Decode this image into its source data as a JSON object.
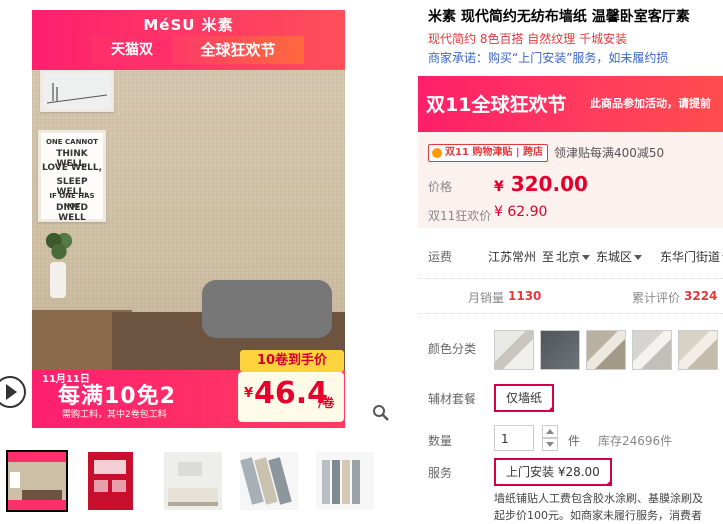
{
  "gallery": {
    "brand": "MéSU 米素",
    "tmall_left": "天猫双",
    "tmall_right": "全球狂欢节",
    "wall_quote": [
      "ONE CANNOT",
      "THINK WELL,",
      "LOVE WELL,",
      "SLEEP WELL,",
      "IF ONE HAS NOT",
      "DINED WELL"
    ],
    "promo_date": "11月11日",
    "promo_main": "每满10免2",
    "promo_sub": "需购工料，其中2卷包工料",
    "promo_tag": "10卷到手价",
    "promo_currency": "¥",
    "promo_price": "46.4",
    "promo_unit": "/卷",
    "thumbnail_count": 5
  },
  "product": {
    "title": "米素 现代简约无纺布墙纸 温馨卧室客厅素",
    "subtitle": "现代简约 8色百搭 自然纹理 千城安装",
    "promise": "商家承诺：购买“上门安装”服务，如未履约损",
    "event_title": "双11全球狂欢节",
    "event_sub": "此商品参加活动，请提前",
    "coupon_badge": "双11 购物津贴 | 跨店",
    "coupon_text": "领津贴每满400减50",
    "price_label": "价格",
    "price_currency": "¥",
    "price_value": "320.00",
    "promo_price_label": "双11狂欢价",
    "promo_price": "¥ 62.90",
    "shipping_label": "运费",
    "ship_from": "江苏常州",
    "ship_to_prefix": "至",
    "ship_city": "北京",
    "ship_district": "东城区",
    "ship_street": "东华门街道",
    "monthly_label": "月销量",
    "monthly_value": "1130",
    "review_label": "累计评价",
    "review_value": "3224",
    "color_label": "颜色分类",
    "accessory_label": "辅材套餐",
    "accessory_option": "仅墙纸",
    "qty_label": "数量",
    "qty_value": "1",
    "qty_unit": "件",
    "stock": "库存24696件",
    "service_label": "服务",
    "service_option": "上门安装 ¥28.00",
    "desc_line1": "墙纸铺贴人工费包含胶水涂刷、基膜涂刷及",
    "desc_line2": "起步价100元。如商家未履行服务，消费者"
  },
  "colors": {
    "accent": "#e4393c",
    "tmall": "#ff1f6f",
    "link": "#3a66c8"
  }
}
